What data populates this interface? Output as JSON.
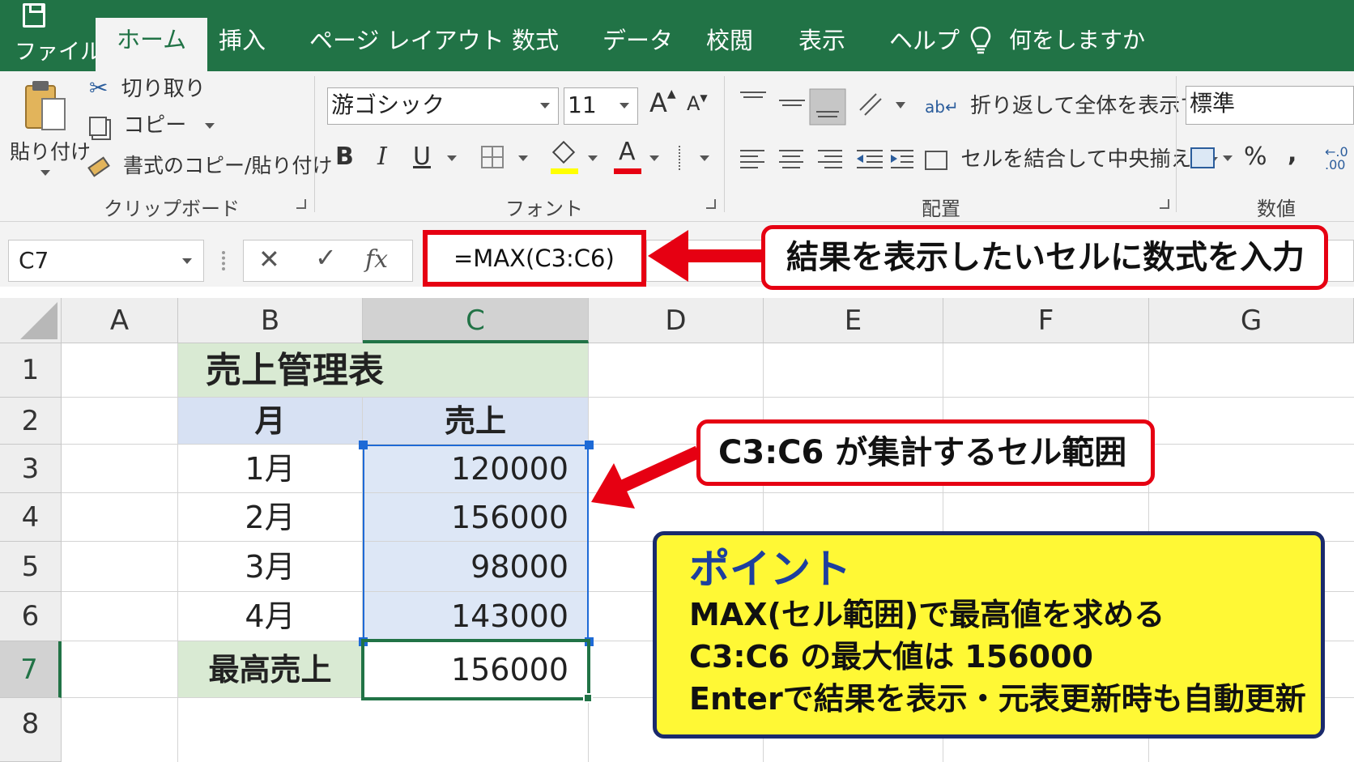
{
  "tabs": {
    "file": "ファイル",
    "home": "ホーム",
    "insert": "挿入",
    "page_layout": "ページ レイアウト",
    "formulas": "数式",
    "data": "データ",
    "review": "校閲",
    "view": "表示",
    "help": "ヘルプ",
    "tell_me": "何をしますか"
  },
  "ribbon": {
    "clipboard": {
      "paste": "貼り付け",
      "cut": "切り取り",
      "copy": "コピー",
      "format_painter": "書式のコピー/貼り付け",
      "group_label": "クリップボード"
    },
    "font": {
      "font_name": "游ゴシック",
      "font_size": "11",
      "bold": "B",
      "italic": "I",
      "underline": "U",
      "grow": "A",
      "shrink": "A",
      "font_color_glyph": "A",
      "group_label": "フォント"
    },
    "alignment": {
      "wrap_text": "折り返して全体を表示する",
      "merge_center": "セルを結合して中央揃え",
      "group_label": "配置"
    },
    "number": {
      "format": "標準",
      "percent": "%",
      "comma": ",",
      "group_label": "数値"
    }
  },
  "formula_bar": {
    "name_box": "C7",
    "fx": "fx",
    "formula": "=MAX(C3:C6)"
  },
  "sheet": {
    "columns": [
      "A",
      "B",
      "C",
      "D",
      "E",
      "F",
      "G"
    ],
    "rows": [
      "1",
      "2",
      "3",
      "4",
      "5",
      "6",
      "7",
      "8"
    ],
    "title": "売上管理表",
    "header_month": "月",
    "header_sales": "売上",
    "months": [
      "1月",
      "2月",
      "3月",
      "4月"
    ],
    "values": [
      "120000",
      "156000",
      "98000",
      "143000"
    ],
    "max_label": "最高売上",
    "max_value": "156000"
  },
  "callouts": {
    "formula": "結果を表示したいセルに数式を入力",
    "range": "C3:C6 が集計するセル範囲"
  },
  "point": {
    "title": "ポイント",
    "lines": [
      "MAX(セル範囲)で最高値を求める",
      "C3:C6 の最大値は 156000",
      "Enterで結果を表示・元表更新時も自動更新"
    ]
  },
  "colors": {
    "excel_green": "#217346",
    "callout_red": "#e60012",
    "point_yellow": "#fff835",
    "point_navy": "#1a2a6c"
  }
}
